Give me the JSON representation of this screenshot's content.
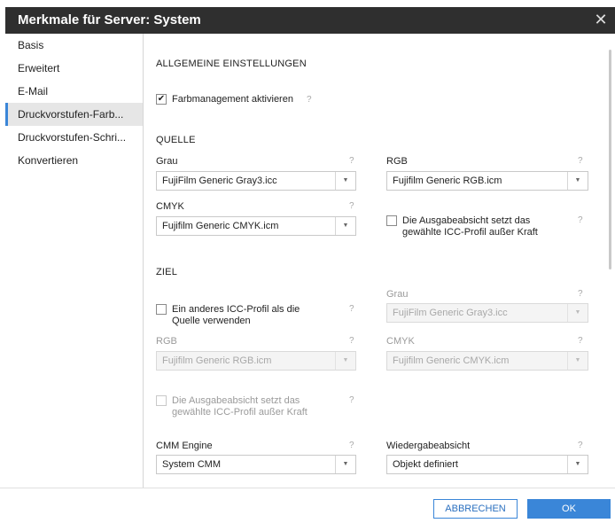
{
  "dialog": {
    "title": "Merkmale für Server: System",
    "close_icon": "close-icon"
  },
  "sidebar": {
    "items": [
      {
        "label": "Basis"
      },
      {
        "label": "Erweitert"
      },
      {
        "label": "E-Mail"
      },
      {
        "label": "Druckvorstufen-Farb..."
      },
      {
        "label": "Druckvorstufen-Schri..."
      },
      {
        "label": "Konvertieren"
      }
    ],
    "active_index": 3
  },
  "general": {
    "section_title": "ALLGEMEINE EINSTELLUNGEN",
    "color_mgmt_label": "Farbmanagement aktivieren",
    "color_mgmt_checked": true,
    "help": "?"
  },
  "source": {
    "section_title": "QUELLE",
    "gray_label": "Grau",
    "gray_value": "FujiFilm Generic Gray3.icc",
    "rgb_label": "RGB",
    "rgb_value": "Fujifilm Generic RGB.icm",
    "cmyk_label": "CMYK",
    "cmyk_value": "Fujifilm Generic CMYK.icm",
    "override_label_1": "Die Ausgabeabsicht setzt das",
    "override_label_2": "gewählte ICC-Profil außer Kraft",
    "override_checked": false,
    "help": "?"
  },
  "target": {
    "section_title": "ZIEL",
    "other_profile_label_1": "Ein anderes ICC-Profil als die",
    "other_profile_label_2": "Quelle verwenden",
    "other_profile_checked": false,
    "gray_label": "Grau",
    "gray_value": "FujiFilm Generic Gray3.icc",
    "rgb_label": "RGB",
    "rgb_value": "Fujifilm Generic RGB.icm",
    "cmyk_label": "CMYK",
    "cmyk_value": "Fujifilm Generic CMYK.icm",
    "override_label_1": "Die Ausgabeabsicht setzt das",
    "override_label_2": "gewählte ICC-Profil außer Kraft",
    "override_checked": false,
    "help": "?"
  },
  "engine": {
    "cmm_label": "CMM Engine",
    "cmm_value": "System CMM",
    "intent_label": "Wiedergabeabsicht",
    "intent_value": "Objekt definiert",
    "help": "?"
  },
  "footer": {
    "cancel_label": "ABBRECHEN",
    "ok_label": "OK"
  },
  "colors": {
    "titlebar": "#2f2f2f",
    "accent": "#3a86d8",
    "active_sidebar": "#e6e6e6"
  }
}
